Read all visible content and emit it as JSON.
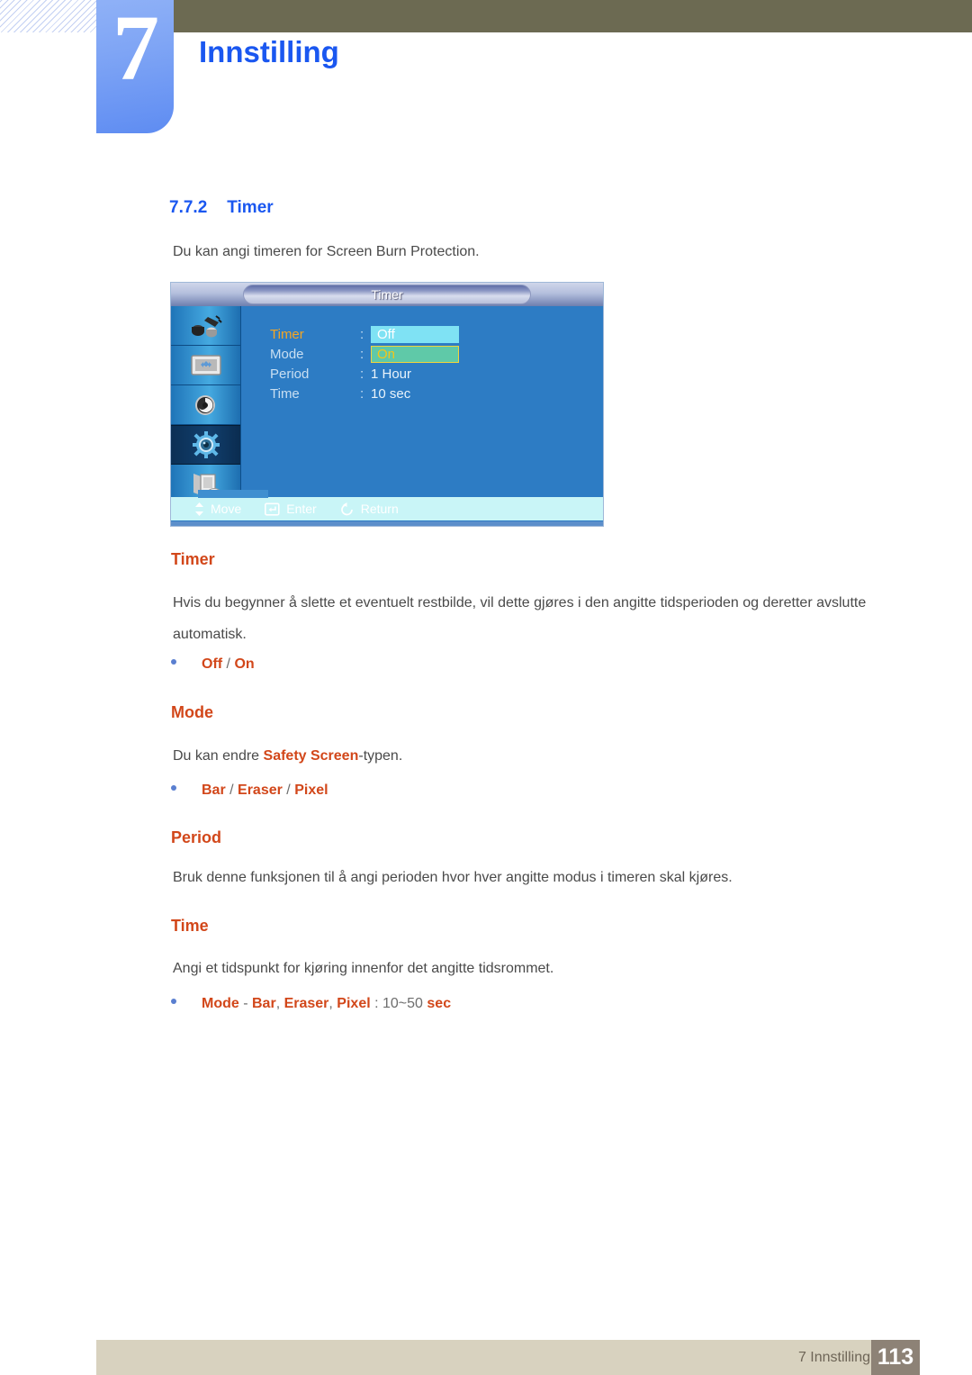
{
  "chapter": {
    "number": "7",
    "title": "Innstilling"
  },
  "section": {
    "number": "7.7.2",
    "title": "Timer",
    "intro": "Du kan angi timeren for Screen Burn Protection."
  },
  "osd": {
    "title": "Timer",
    "sidebar_icons": [
      "input-source-icon",
      "picture-screen-icon",
      "sound-speaker-icon",
      "setup-gear-icon",
      "multi-control-icon"
    ],
    "active_sidebar_index": 3,
    "rows": [
      {
        "label": "Timer",
        "colon": ":",
        "value": "Off",
        "highlight": "cyan",
        "selected": true
      },
      {
        "label": "Mode",
        "colon": ":",
        "value": "On",
        "highlight": "teal",
        "selected": false
      },
      {
        "label": "Period",
        "colon": ":",
        "value": "1 Hour",
        "highlight": "none",
        "selected": false
      },
      {
        "label": "Time",
        "colon": ":",
        "value": "10 sec",
        "highlight": "none",
        "selected": false
      }
    ],
    "footer_items": [
      {
        "icon": "move-updown-icon",
        "label": "Move"
      },
      {
        "icon": "enter-key-icon",
        "label": "Enter"
      },
      {
        "icon": "return-arrow-icon",
        "label": "Return"
      }
    ]
  },
  "sections": [
    {
      "heading": "Timer",
      "paragraph": "Hvis du begynner å slette et eventuelt restbilde, vil dette gjøres i den angitte tidsperioden og deretter avslutte automatisk.",
      "bullet": {
        "parts": [
          {
            "text": "Off",
            "style": "orange"
          },
          {
            "text": " / ",
            "style": "gray"
          },
          {
            "text": "On",
            "style": "orange"
          }
        ]
      }
    },
    {
      "heading": "Mode",
      "paragraph_parts": [
        {
          "text": "Du kan endre ",
          "style": "gray"
        },
        {
          "text": "Safety Screen",
          "style": "orange"
        },
        {
          "text": "-typen.",
          "style": "gray"
        }
      ],
      "bullet": {
        "parts": [
          {
            "text": "Bar",
            "style": "orange"
          },
          {
            "text": " / ",
            "style": "gray"
          },
          {
            "text": "Eraser",
            "style": "orange"
          },
          {
            "text": " / ",
            "style": "gray"
          },
          {
            "text": "Pixel",
            "style": "orange"
          }
        ]
      }
    },
    {
      "heading": "Period",
      "paragraph": "Bruk denne funksjonen til å angi perioden hvor hver angitte modus i timeren skal kjøres."
    },
    {
      "heading": "Time",
      "paragraph": "Angi et tidspunkt for kjøring innenfor det angitte tidsrommet.",
      "bullet": {
        "parts": [
          {
            "text": "Mode",
            "style": "orange"
          },
          {
            "text": " - ",
            "style": "gray"
          },
          {
            "text": "Bar",
            "style": "orange"
          },
          {
            "text": ", ",
            "style": "gray"
          },
          {
            "text": "Eraser",
            "style": "orange"
          },
          {
            "text": ", ",
            "style": "gray"
          },
          {
            "text": "Pixel",
            "style": "orange"
          },
          {
            "text": " : ",
            "style": "gray"
          },
          {
            "text": "10~50 ",
            "style": "gray"
          },
          {
            "text": "sec",
            "style": "orange"
          }
        ]
      }
    }
  ],
  "footer": {
    "label": "7 Innstilling",
    "page": "113"
  },
  "colors": {
    "accent_blue": "#1a57f0",
    "accent_orange": "#d2471a",
    "header_bar": "#6c6a52",
    "footer_bar": "#d8d2bf",
    "page_box": "#8d8276",
    "osd_blue": "#2d7cc4"
  }
}
